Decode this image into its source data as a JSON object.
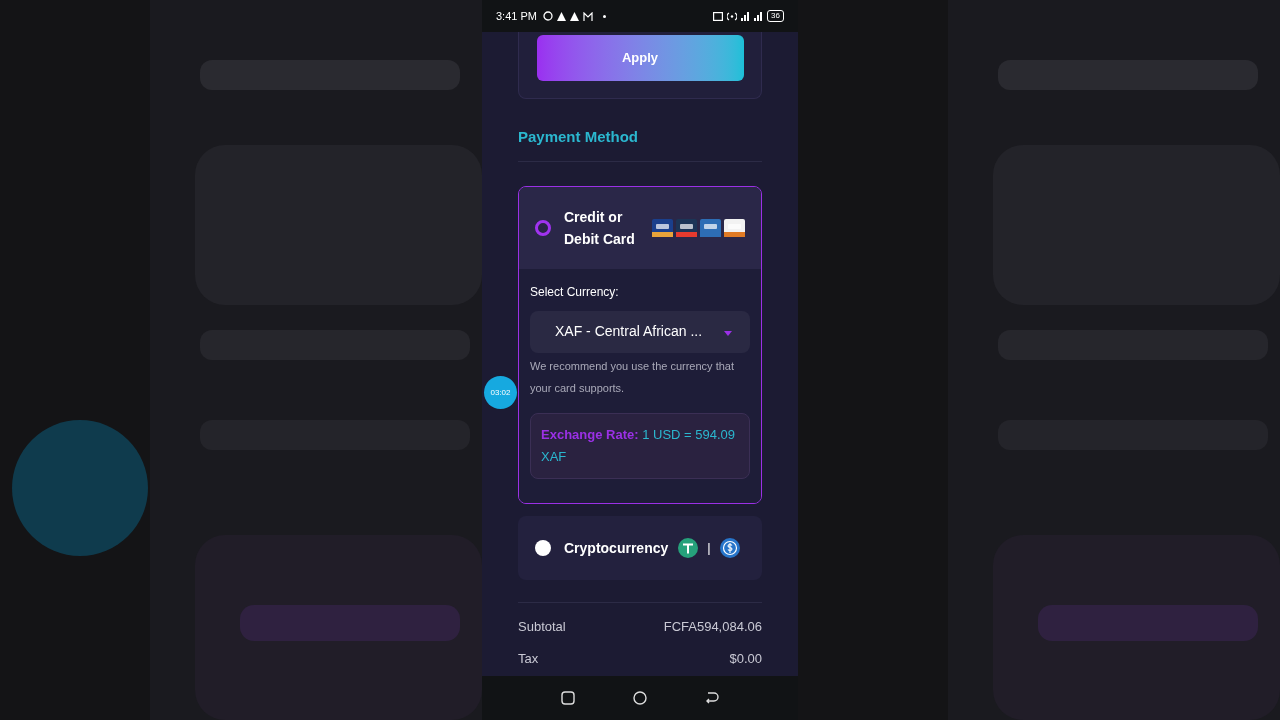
{
  "status_bar": {
    "time": "3:41 PM",
    "battery": "36"
  },
  "apply_button": "Apply",
  "section_title": "Payment Method",
  "payment_methods": [
    {
      "kind": "card",
      "label": "Credit or Debit Card",
      "selected": true,
      "currency_label": "Select Currency:",
      "currency_value": "XAF - Central African ...",
      "hint": "We recommend you use the currency that your card supports.",
      "rate_label": "Exchange Rate:",
      "rate_value": "1 USD = 594.09 XAF"
    },
    {
      "kind": "crypto",
      "label": "Cryptocurrency",
      "selected": false,
      "separator": "|"
    }
  ],
  "summary": [
    {
      "label": "Subtotal",
      "value": "FCFA594,084.06"
    },
    {
      "label": "Tax",
      "value": "$0.00"
    }
  ],
  "recorder_timer": "03:02"
}
